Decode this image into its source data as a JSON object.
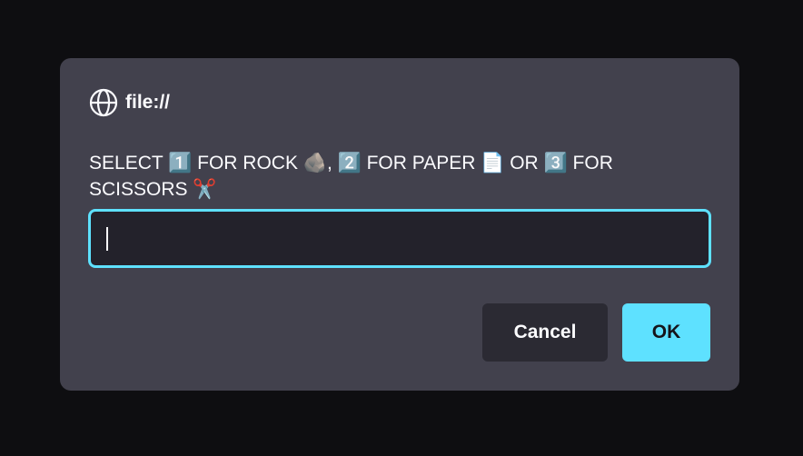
{
  "dialog": {
    "origin": "file://",
    "origin_icon": "globe-icon",
    "message": "SELECT 1️⃣ FOR ROCK 🪨, 2️⃣ FOR PAPER 📄 OR 3️⃣ FOR SCISSORS ✂️",
    "input_value": "",
    "cancel_label": "Cancel",
    "ok_label": "OK"
  },
  "colors": {
    "backdrop": "#0e0e11",
    "dialog_bg": "#42414d",
    "accent": "#5ee1ff",
    "input_bg": "#23222b",
    "cancel_bg": "#2b2a33",
    "text": "#fbfbfe"
  }
}
